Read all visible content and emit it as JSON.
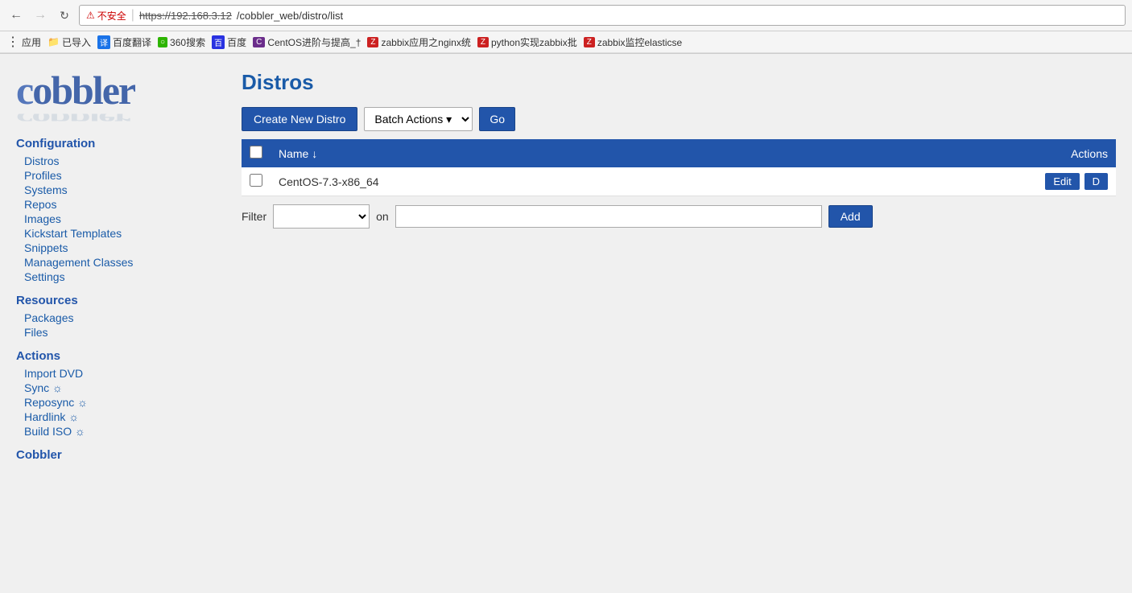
{
  "browser": {
    "back_btn": "←",
    "forward_btn": "→",
    "reload_btn": "↺",
    "security_warning": "不安全",
    "url_secure": "https://",
    "url_host": "192.168.3.12",
    "url_path": "/cobbler_web/distro/list",
    "bookmarks": [
      {
        "id": "apps",
        "label": "应用",
        "icon": "grid"
      },
      {
        "id": "imported",
        "label": "已导入",
        "icon": "folder"
      },
      {
        "id": "translate",
        "label": "百度翻译",
        "icon": "translate"
      },
      {
        "id": "360search",
        "label": "360搜索",
        "icon": "360"
      },
      {
        "id": "baidu",
        "label": "百度",
        "icon": "baidu"
      },
      {
        "id": "centos",
        "label": "CentOS进阶与提高_†",
        "icon": "centos"
      },
      {
        "id": "zabbix-nginx",
        "label": "zabbix应用之nginx统",
        "icon": "zabbix"
      },
      {
        "id": "zabbix-python",
        "label": "python实现zabbix批",
        "icon": "zabbix"
      },
      {
        "id": "zabbix-elastic",
        "label": "zabbix监控elasticse",
        "icon": "zabbix"
      }
    ]
  },
  "logo": {
    "text": "cobbler"
  },
  "sidebar": {
    "configuration_title": "Configuration",
    "config_items": [
      {
        "id": "distros",
        "label": "Distros"
      },
      {
        "id": "profiles",
        "label": "Profiles"
      },
      {
        "id": "systems",
        "label": "Systems"
      },
      {
        "id": "repos",
        "label": "Repos"
      },
      {
        "id": "images",
        "label": "Images"
      },
      {
        "id": "kickstart-templates",
        "label": "Kickstart Templates"
      },
      {
        "id": "snippets",
        "label": "Snippets"
      },
      {
        "id": "management-classes",
        "label": "Management Classes"
      },
      {
        "id": "settings",
        "label": "Settings"
      }
    ],
    "resources_title": "Resources",
    "resource_items": [
      {
        "id": "packages",
        "label": "Packages"
      },
      {
        "id": "files",
        "label": "Files"
      }
    ],
    "actions_title": "Actions",
    "action_items": [
      {
        "id": "import-dvd",
        "label": "Import DVD"
      },
      {
        "id": "sync",
        "label": "Sync ☼"
      },
      {
        "id": "reposync",
        "label": "Reposync ☼"
      },
      {
        "id": "hardlink",
        "label": "Hardlink ☼"
      },
      {
        "id": "build-iso",
        "label": "Build ISO ☼"
      }
    ],
    "cobbler_title": "Cobbler"
  },
  "main": {
    "page_title": "Distros",
    "create_btn_label": "Create New Distro",
    "batch_actions_label": "Batch Actions",
    "go_btn_label": "Go",
    "table": {
      "header_name": "Name ↓",
      "header_actions": "Actions",
      "rows": [
        {
          "id": "centos73",
          "name": "CentOS-7.3-x86_64",
          "edit_label": "Edit",
          "delete_label": "D"
        }
      ]
    },
    "filter": {
      "label": "Filter",
      "on_label": "on",
      "add_label": "Add",
      "select_placeholder": "",
      "input_placeholder": ""
    }
  }
}
